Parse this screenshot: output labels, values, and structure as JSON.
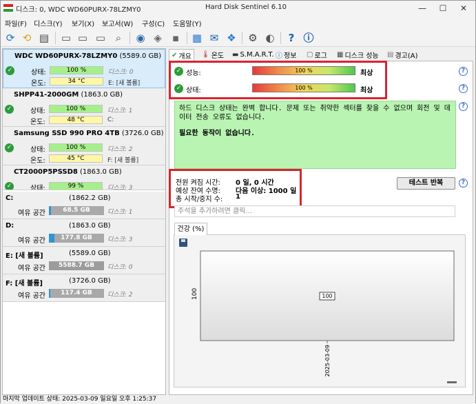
{
  "title": {
    "left": "디스크: 0, WDC WD60PURX-78LZMY0",
    "center": "Hard Disk Sentinel 6.10"
  },
  "window_buttons": {
    "minimize": "—",
    "maximize": "☐",
    "close": "✕"
  },
  "menu": [
    "파일(F)",
    "디스크(Y)",
    "보기(X)",
    "보고서(W)",
    "구성(C)",
    "도움말(Y)"
  ],
  "toolbar_icons": [
    "refresh-icon",
    "refresh-all-icon",
    "disk-list-icon",
    "disk-test-icon",
    "disk-test2-icon",
    "disk-test3-icon",
    "disk-scan-icon",
    "disk-info-icon",
    "network-disk-icon",
    "usb-disk-icon",
    "usb-disk2-icon",
    "report-icon",
    "mail-icon",
    "network-icon",
    "settings-icon",
    "sound-icon",
    "help-icon",
    "info-icon"
  ],
  "disks": [
    {
      "name": "WDC WD60PURX-78LZMY0",
      "size": "(5589.0 GB)",
      "health_label": "상태:",
      "health": "100 %",
      "health_meta": "디스크: 0",
      "temp_label": "온도:",
      "temp": "34 °C",
      "temp_meta": "E: [새 볼륨]"
    },
    {
      "name": "SHPP41-2000GM",
      "size": "(1863.0 GB)",
      "health_label": "상태:",
      "health": "100 %",
      "health_meta": "디스크: 1",
      "temp_label": "온도:",
      "temp": "48 °C",
      "temp_meta": "C:"
    },
    {
      "name": "Samsung SSD 990 PRO 4TB",
      "size": "(3726.0 GB)",
      "health_label": "상태:",
      "health": "100 %",
      "health_meta": "디스크: 2",
      "temp_label": "온도:",
      "temp": "45 °C",
      "temp_meta": "F: [새 볼륨]"
    },
    {
      "name": "CT2000P5PSSD8",
      "size": "(1863.0 GB)",
      "health_label": "상태:",
      "health": "99 %",
      "health_meta": "디스크: 3"
    }
  ],
  "volumes": [
    {
      "name": "C:",
      "size": "(1862.2 GB)",
      "free_label": "여유 공간",
      "free": "68.5 GB",
      "free_fraction": 0.04,
      "meta": "디스크: 1"
    },
    {
      "name": "D:",
      "size": "(1863.0 GB)",
      "free_label": "여유 공간",
      "free": "177.8 GB",
      "free_fraction": 0.1,
      "meta": "디스크: 3"
    },
    {
      "name": "E: [새 볼륨]",
      "size": "(5589.0 GB)",
      "free_label": "여유 공간",
      "free": "5588.7 GB",
      "free_fraction": 1.0,
      "meta": "디스크: 0"
    },
    {
      "name": "F: [새 볼륨]",
      "size": "(3726.0 GB)",
      "free_label": "여유 공간",
      "free": "117.4 GB",
      "free_fraction": 0.03,
      "meta": "디스크: 2"
    }
  ],
  "tabs": [
    "개요",
    "온도",
    "S.M.A.R.T.",
    "정보",
    "로그",
    "디스크 성능",
    "경고(A)"
  ],
  "overview": {
    "performance_label": "성능:",
    "performance_value": "100 %",
    "performance_rating": "최상",
    "health_label": "상태:",
    "health_value": "100 %",
    "health_rating": "최상",
    "status_line1": "하드 디스크 상태는 완벽 합니다. 문제 또는 취약한 섹터를 찾을 수 없으며 회전 및 데이터 전송 오류도 없습니다.",
    "status_line2": "필요한 동작이 없습니다.",
    "power_on_label": "전원 켜짐 시간:",
    "power_on_value": "0 일, 0 시간",
    "lifetime_label": "예상 잔여 수명:",
    "lifetime_value": "다음 이상: 1000 일",
    "starts_label": "총 시작/중지 수:",
    "starts_value": "1",
    "test_button": "테스트 반복",
    "note_placeholder": "주석을 추가하려면 클릭..."
  },
  "chart_data": {
    "type": "line",
    "title": "건강 (%)",
    "ylabel": "100",
    "x": [
      "2025-03-09"
    ],
    "series": [
      {
        "values": [
          100
        ]
      }
    ],
    "data_labels": [
      "100"
    ]
  },
  "status_bar": "마지막 업데이트 상태: 2025-03-09 일요일 오후 1:25:37",
  "colors": {
    "ok": "#2e9b3c",
    "health_bar": "#a6f08a",
    "temp_bar": "#fff7a6",
    "volume_fill": "#2f95d6",
    "status_box": "#b9f4b2",
    "highlight": "#d8242c"
  }
}
